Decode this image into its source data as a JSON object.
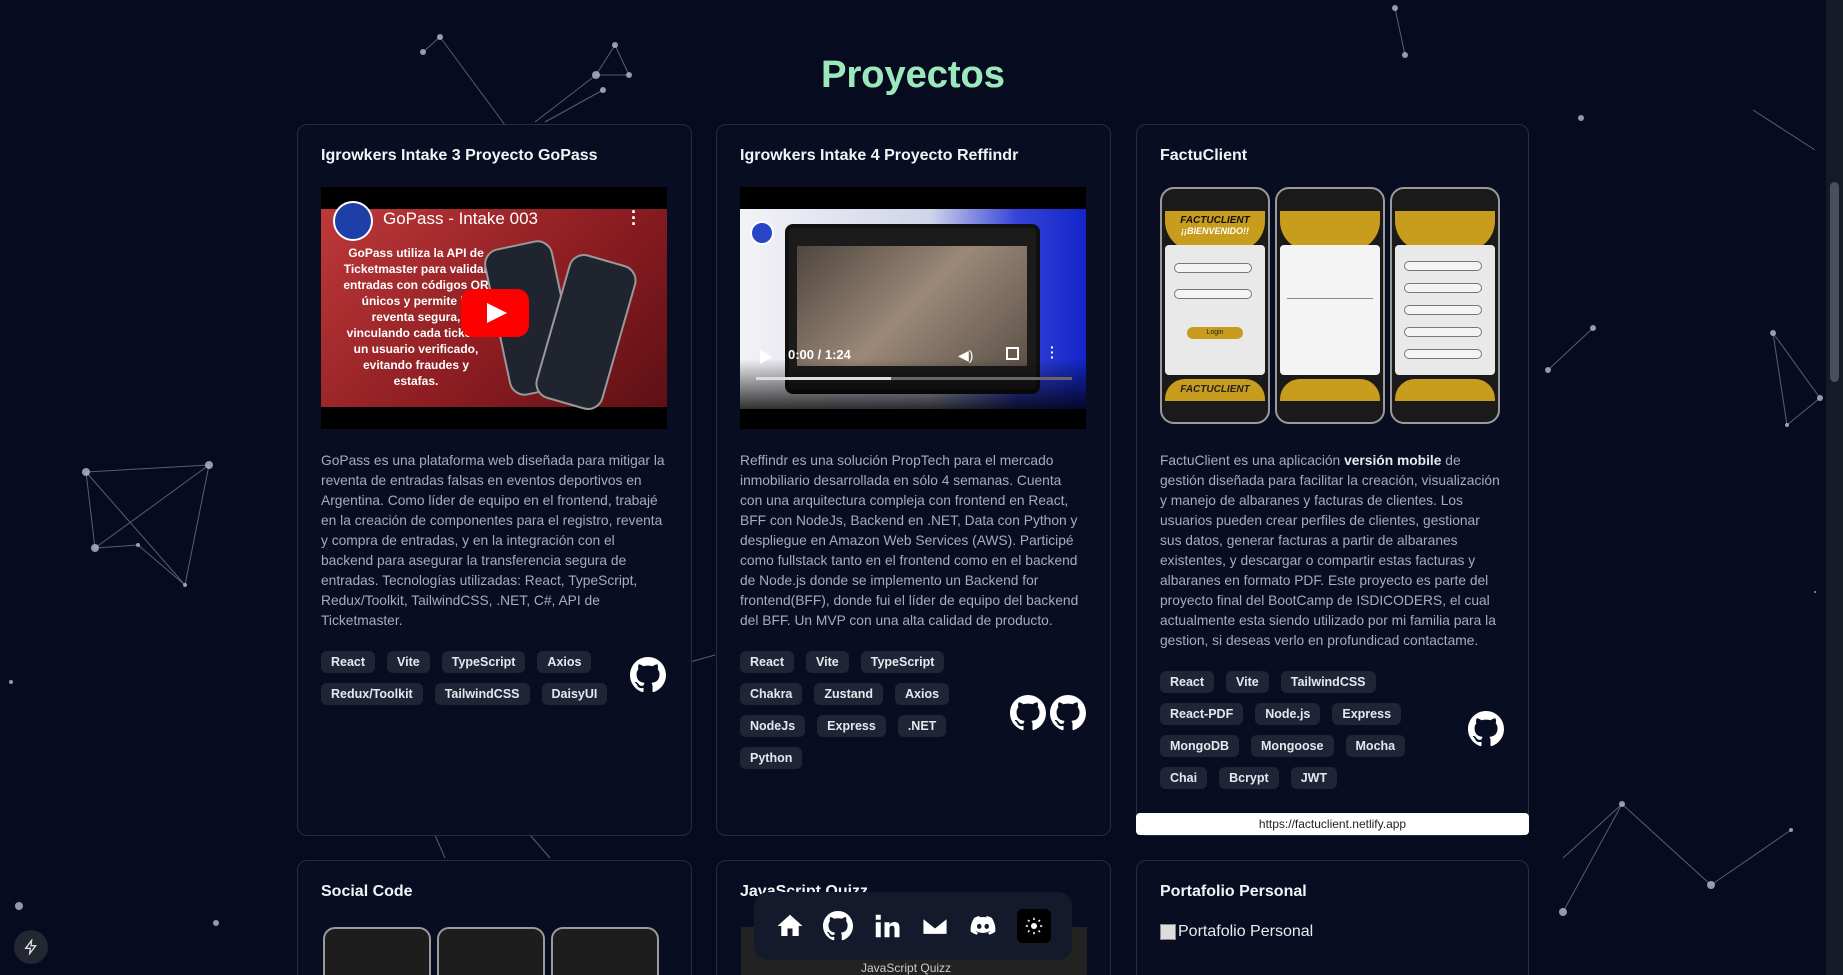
{
  "section": {
    "title": "Proyectos"
  },
  "cards": [
    {
      "title": "Igrowkers Intake 3 Proyecto GoPass",
      "video_title": "GoPass - Intake 003",
      "thumb_text": "GoPass utiliza la API de Ticketmaster para validar entradas con códigos QR únicos y permite la reventa segura, vinculando cada ticket a un usuario verificado, evitando fraudes y estafas.",
      "description": "GoPass es una plataforma web diseñada para mitigar la reventa de entradas falsas en eventos deportivos en Argentina. Como líder de equipo en el frontend, trabajé en la creación de componentes para el registro, reventa y compra de entradas, y en la integración con el backend para asegurar la transferencia segura de entradas. Tecnologías utilizadas: React, TypeScript, Redux/Toolkit, TailwindCSS, .NET, C#, API de Ticketmaster.",
      "tags": [
        "React",
        "Vite",
        "TypeScript",
        "Axios",
        "Redux/Toolkit",
        "TailwindCSS",
        "DaisyUI"
      ]
    },
    {
      "title": "Igrowkers Intake 4 Proyecto Reffindr",
      "video_time": "0:00 / 1:24",
      "description": "Reffindr es una solución PropTech para el mercado inmobiliario desarrollada en sólo 4 semanas. Cuenta con una arquitectura compleja con frontend en React, BFF con NodeJs, Backend en .NET, Data con Python y despliegue en Amazon Web Services (AWS). Participé como fullstack tanto en el frontend como en el backend de Node.js donde se implemento un Backend for frontend(BFF), donde fui el líder de equipo del backend del BFF. Un MVP con una alta calidad de producto.",
      "tags": [
        "React",
        "Vite",
        "TypeScript",
        "Chakra",
        "Zustand",
        "Axios",
        "NodeJs",
        "Express",
        ".NET",
        "Python"
      ]
    },
    {
      "title": "FactuClient",
      "description_pre": "FactuClient es una aplicación ",
      "description_bold": "versión mobile",
      "description_post": " de gestión diseñada para facilitar la creación, visualización y manejo de albaranes y facturas de clientes. Los usuarios pueden crear perfiles de clientes, gestionar sus datos, generar facturas a partir de albaranes existentes, y descargar o compartir estas facturas y albaranes en formato PDF. Este proyecto es parte del proyecto final del BootCamp de ISDICODERS, el cual actualmente esta siendo utilizado por mi familia para la gestion, si deseas verlo en profundicad contactame.",
      "tags": [
        "React",
        "Vite",
        "TailwindCSS",
        "React-PDF",
        "Node.js",
        "Express",
        "MongoDB",
        "Mongoose",
        "Mocha",
        "Chai",
        "Bcrypt",
        "JWT"
      ],
      "link": "https://factuclient.netlify.app",
      "phone_texts": [
        "FACTUCLIENT",
        "¡¡BIENVENIDO!!",
        "Login",
        "FACTUCLIENT"
      ]
    },
    {
      "title": "Social Code"
    },
    {
      "title": "JavaScript Quizz",
      "thumb_label": "JavaScript Quizz"
    },
    {
      "title": "Portafolio Personal",
      "img_alt": "Portafolio Personal"
    }
  ],
  "colors": {
    "background": "#070b1f",
    "accent": "#9ae8bb",
    "card_border": "#262c44",
    "tag_bg": "#1f2537"
  },
  "dock": {
    "icons": [
      "home-icon",
      "github-icon",
      "linkedin-icon",
      "mail-icon",
      "discord-icon",
      "sun-icon"
    ]
  }
}
